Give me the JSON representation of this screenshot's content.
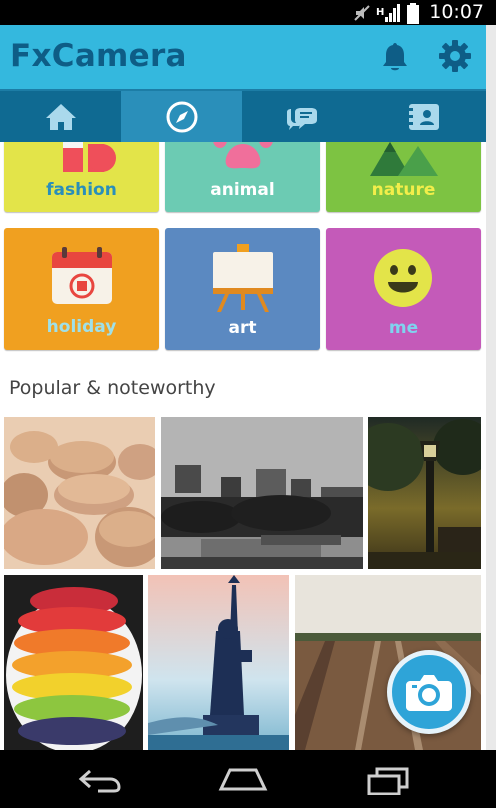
{
  "status_bar": {
    "time": "10:07",
    "icons": [
      "mute-icon",
      "signal-icon",
      "battery-icon"
    ]
  },
  "app_bar": {
    "title": "FxCamera",
    "actions": [
      "bell-icon",
      "gear-icon"
    ]
  },
  "tabs": [
    {
      "icon": "home-icon",
      "active": false
    },
    {
      "icon": "compass-icon",
      "active": true
    },
    {
      "icon": "chat-icon",
      "active": false
    },
    {
      "icon": "contact-card-icon",
      "active": false
    }
  ],
  "categories": [
    {
      "label": "fashion",
      "bg": "#e3e449",
      "label_color": "#2a8fba",
      "icon": "fashion-icon"
    },
    {
      "label": "animal",
      "bg": "#6ccbb3",
      "label_color": "#ffffff",
      "icon": "paw-icon"
    },
    {
      "label": "nature",
      "bg": "#7dc342",
      "label_color": "#f2ee4a",
      "icon": "mountain-icon"
    },
    {
      "label": "holiday",
      "bg": "#f0a020",
      "label_color": "#9fe0e8",
      "icon": "calendar-icon"
    },
    {
      "label": "art",
      "bg": "#5b89c1",
      "label_color": "#ffffff",
      "icon": "easel-icon"
    },
    {
      "label": "me",
      "bg": "#c45ab9",
      "label_color": "#7fd3ef",
      "icon": "smiley-icon"
    }
  ],
  "section": {
    "title": "Popular & noteworthy"
  },
  "photos": [
    {
      "subject": "macarons"
    },
    {
      "subject": "city skyline"
    },
    {
      "subject": "street lamp at sunset"
    },
    {
      "subject": "fruit platter"
    },
    {
      "subject": "statue of liberty"
    },
    {
      "subject": "muddy field"
    }
  ],
  "fab": {
    "icon": "camera-icon"
  },
  "nav": [
    "back-icon",
    "home-nav-icon",
    "recent-apps-icon"
  ]
}
